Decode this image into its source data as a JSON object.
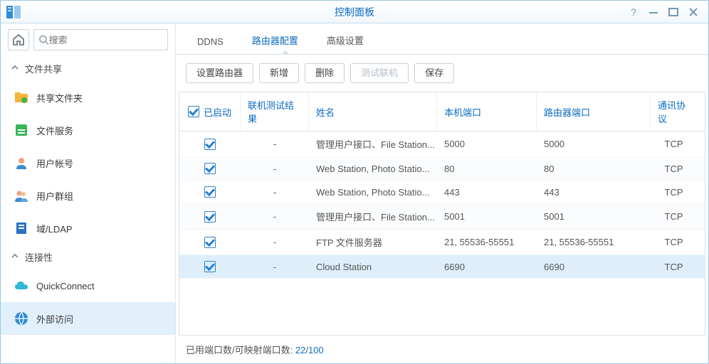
{
  "header": {
    "title": "控制面板"
  },
  "sidebar": {
    "search_placeholder": "搜索",
    "categories": [
      {
        "label": "文件共享",
        "items": [
          "共享文件夹",
          "文件服务",
          "用户帐号",
          "用户群组",
          "域/LDAP"
        ]
      },
      {
        "label": "连接性",
        "items": [
          "QuickConnect",
          "外部访问"
        ]
      }
    ]
  },
  "main": {
    "tabs": [
      "DDNS",
      "路由器配置",
      "高级设置"
    ],
    "toolbar": [
      "设置路由器",
      "新增",
      "删除",
      "测试联机",
      "保存"
    ],
    "columns": {
      "enabled": "已启动",
      "test": "联机测试结果",
      "name": "姓名",
      "local": "本机端口",
      "router": "路由器端口",
      "protocol": "通讯协议"
    },
    "rows": [
      {
        "enabled": true,
        "test": "-",
        "name": "管理用户接口、File Station...",
        "local": "5000",
        "router": "5000",
        "protocol": "TCP",
        "selected": false
      },
      {
        "enabled": true,
        "test": "-",
        "name": "Web Station, Photo Statio...",
        "local": "80",
        "router": "80",
        "protocol": "TCP",
        "selected": false
      },
      {
        "enabled": true,
        "test": "-",
        "name": "Web Station, Photo Statio...",
        "local": "443",
        "router": "443",
        "protocol": "TCP",
        "selected": false
      },
      {
        "enabled": true,
        "test": "-",
        "name": "管理用户接口、File Station...",
        "local": "5001",
        "router": "5001",
        "protocol": "TCP",
        "selected": false
      },
      {
        "enabled": true,
        "test": "-",
        "name": "FTP 文件服务器",
        "local": "21, 55536-55551",
        "router": "21, 55536-55551",
        "protocol": "TCP",
        "selected": false
      },
      {
        "enabled": true,
        "test": "-",
        "name": "Cloud Station",
        "local": "6690",
        "router": "6690",
        "protocol": "TCP",
        "selected": true
      }
    ],
    "footer": {
      "label": "已用端口数/可映射端口数: ",
      "used": "22",
      "total": "100"
    }
  }
}
